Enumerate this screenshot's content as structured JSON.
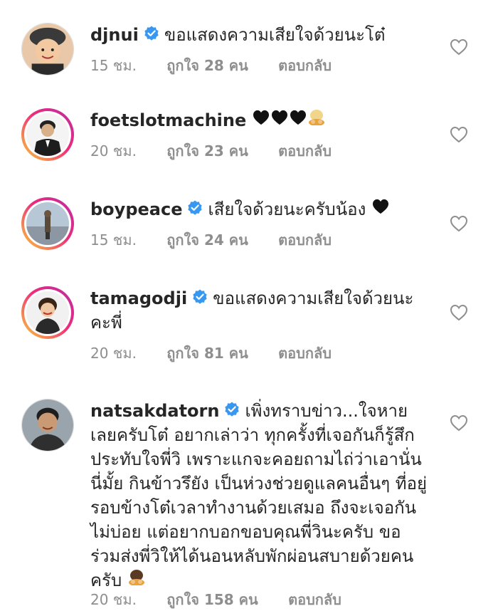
{
  "comments": [
    {
      "username": "djnui",
      "verified": true,
      "text": "ขอแสดงความเสียใจด้วยนะโต๋",
      "time": "15 ชม.",
      "likes": "ถูกใจ 28 คน",
      "reply": "ตอบกลับ"
    },
    {
      "username": "foetslotmachine",
      "verified": false,
      "text": "",
      "time": "20 ชม.",
      "likes": "ถูกใจ 23 คน",
      "reply": "ตอบกลับ"
    },
    {
      "username": "boypeace",
      "verified": true,
      "text": "เสียใจด้วยนะครับน้อง",
      "time": "15 ชม.",
      "likes": "ถูกใจ 24 คน",
      "reply": "ตอบกลับ"
    },
    {
      "username": "tamagodji",
      "verified": true,
      "text": "ขอแสดงความเสียใจด้วยนะคะพี่",
      "time": "20 ชม.",
      "likes": "ถูกใจ 81 คน",
      "reply": "ตอบกลับ"
    },
    {
      "username": "natsakdatorn",
      "verified": true,
      "text": "เพิ่งทราบข่าว...ใจหายเลยครับโต๋ อยากเล่าว่า ทุกครั้งที่เจอกันก็รู้สึกประทับใจพี่วิ เพราะแกจะคอยถามไถ่ว่าเอานั่นนี่มั้ย กินข้าวรึยัง เป็นห่วงช่วยดูแลคนอื่นๆ ที่อยู่รอบข้างโต๋เวลาทำงานด้วยเสมอ ถึงจะเจอกันไม่บ่อย แต่อยากบอกขอบคุณพี่วินะครับ ขอร่วมส่งพี่วิให้ได้นอนหลับพักผ่อนสบายด้วยคนครับ",
      "time": "20 ชม.",
      "likes": "ถูกใจ 158 คน",
      "reply": "ตอบกลับ"
    }
  ],
  "icons": {
    "verified": "verified-badge-icon",
    "heart": "heart-outline-icon",
    "black_heart": "black-heart-emoji",
    "pray": "person-bowing-emoji"
  },
  "colors": {
    "verified_blue": "#3897f0",
    "meta_gray": "#8e8e8e",
    "text": "#262626"
  }
}
